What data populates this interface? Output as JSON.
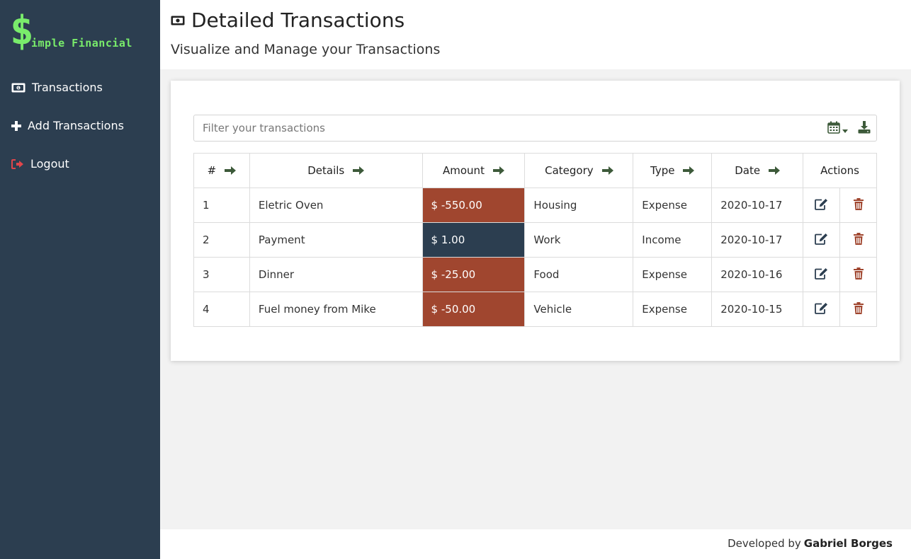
{
  "app": {
    "logo_symbol": "$",
    "logo_text": "imple Financial",
    "logo_color": "#79ec6b",
    "sidebar_color": "#2c3e50"
  },
  "sidebar": {
    "items": [
      {
        "label": "Transactions",
        "icon": "money-bill-icon"
      },
      {
        "label": "Add Transactions",
        "icon": "plus-icon"
      },
      {
        "label": "Logout",
        "icon": "sign-out-icon"
      }
    ]
  },
  "header": {
    "title": "Detailed Transactions",
    "subtitle": "Visualize and Manage your Transactions"
  },
  "filter": {
    "placeholder": "Filter your transactions",
    "value": ""
  },
  "table": {
    "columns": [
      "#",
      "Details",
      "Amount",
      "Category",
      "Type",
      "Date",
      "Actions"
    ],
    "rows": [
      {
        "id": "1",
        "details": "Eletric Oven",
        "amount": "$ -550.00",
        "category": "Housing",
        "type": "Expense",
        "date": "2020-10-17"
      },
      {
        "id": "2",
        "details": "Payment",
        "amount": "$ 1.00",
        "category": "Work",
        "type": "Income",
        "date": "2020-10-17"
      },
      {
        "id": "3",
        "details": "Dinner",
        "amount": "$ -25.00",
        "category": "Food",
        "type": "Expense",
        "date": "2020-10-16"
      },
      {
        "id": "4",
        "details": "Fuel money from Mike",
        "amount": "$ -50.00",
        "category": "Vehicle",
        "type": "Expense",
        "date": "2020-10-15"
      }
    ]
  },
  "colors": {
    "expense": "#a0462f",
    "income": "#2c3e50",
    "arrow": "#3d5a3a",
    "delete": "#a0462f"
  },
  "footer": {
    "developed_by": "Developed by",
    "author": "Gabriel Borges"
  }
}
